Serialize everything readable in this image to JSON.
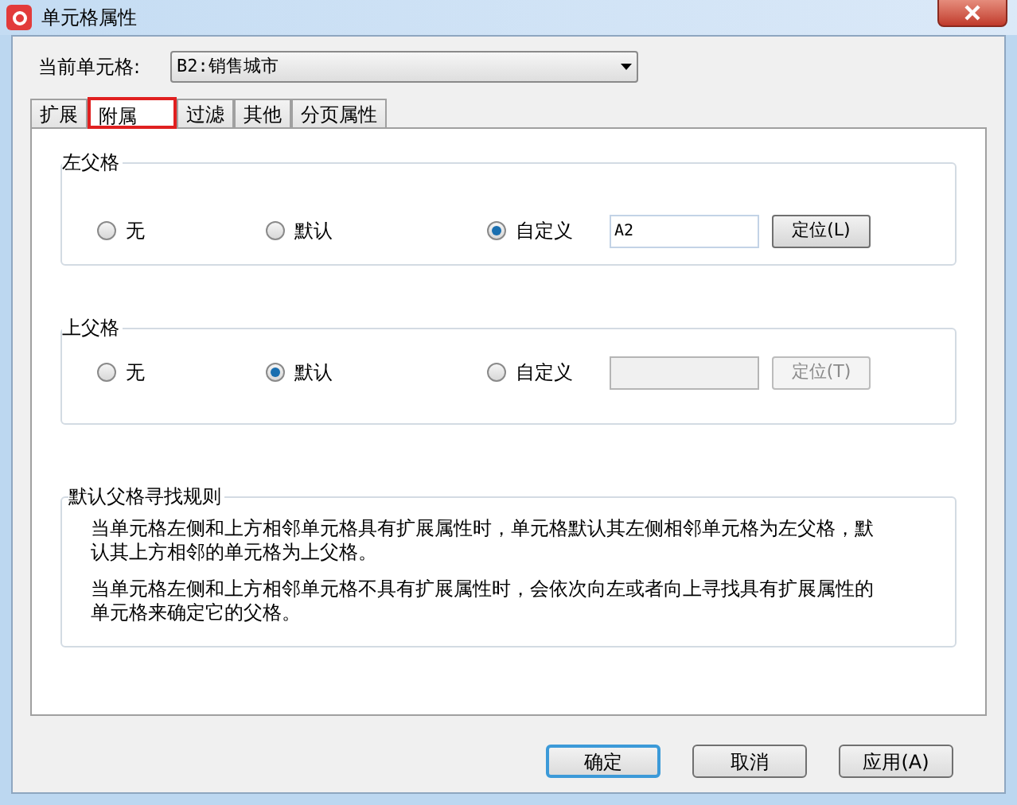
{
  "window": {
    "title": "单元格属性"
  },
  "current_cell": {
    "label": "当前单元格:",
    "value": "B2:销售城市"
  },
  "tabs": [
    {
      "label": "扩展",
      "selected": false,
      "highlighted": false
    },
    {
      "label": "附属",
      "selected": true,
      "highlighted": true
    },
    {
      "label": "过滤",
      "selected": false,
      "highlighted": false
    },
    {
      "label": "其他",
      "selected": false,
      "highlighted": false
    },
    {
      "label": "分页属性",
      "selected": false,
      "highlighted": false
    }
  ],
  "groups": [
    {
      "title": "左父格",
      "options": [
        {
          "label": "无",
          "selected": false
        },
        {
          "label": "默认",
          "selected": false
        },
        {
          "label": "自定义",
          "selected": true
        }
      ],
      "field": {
        "value": "A2",
        "disabled": false
      },
      "button": {
        "label": "定位(L)",
        "disabled": false
      }
    },
    {
      "title": "上父格",
      "options": [
        {
          "label": "无",
          "selected": false
        },
        {
          "label": "默认",
          "selected": true
        },
        {
          "label": "自定义",
          "selected": false
        }
      ],
      "field": {
        "disabled": true
      },
      "button": {
        "label": "定位(T)",
        "disabled": true
      }
    }
  ],
  "rules": {
    "title": "默认父格寻找规则",
    "paragraphs": [
      "当单元格左侧和上方相邻单元格具有扩展属性时，单元格默认其左侧相邻单元格为左父格，默认其上方相邻的单元格为上父格。",
      "当单元格左侧和上方相邻单元格不具有扩展属性时，会依次向左或者向上寻找具有扩展属性的单元格来确定它的父格。"
    ]
  },
  "buttons": [
    {
      "label": "确定",
      "default": true
    },
    {
      "label": "取消",
      "default": false
    },
    {
      "label": "应用(A)",
      "default": false
    }
  ]
}
